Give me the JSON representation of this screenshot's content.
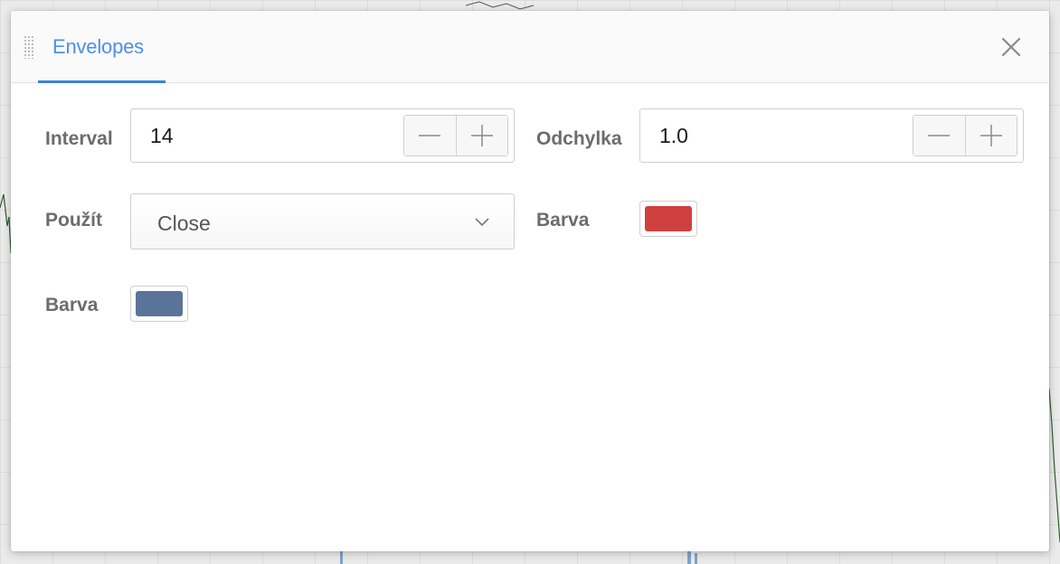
{
  "dialog": {
    "tab_label": "Envelopes"
  },
  "fields": {
    "interval": {
      "label": "Interval",
      "value": "14"
    },
    "deviation": {
      "label": "Odchylka",
      "value": "1.0"
    },
    "source": {
      "label": "Použít",
      "value": "Close"
    },
    "band_color": {
      "label": "Barva",
      "color": "#cf4140"
    },
    "line_color": {
      "label": "Barva",
      "color": "#5a7499"
    }
  },
  "icons": {
    "drag": "drag-handle-icon",
    "close": "close-icon",
    "minus": "minus-icon",
    "plus": "plus-icon",
    "chevron": "chevron-down-icon"
  },
  "theme": {
    "accent": "#4d90e8",
    "label": "#6c6c6c",
    "border": "#cfcfcf"
  }
}
